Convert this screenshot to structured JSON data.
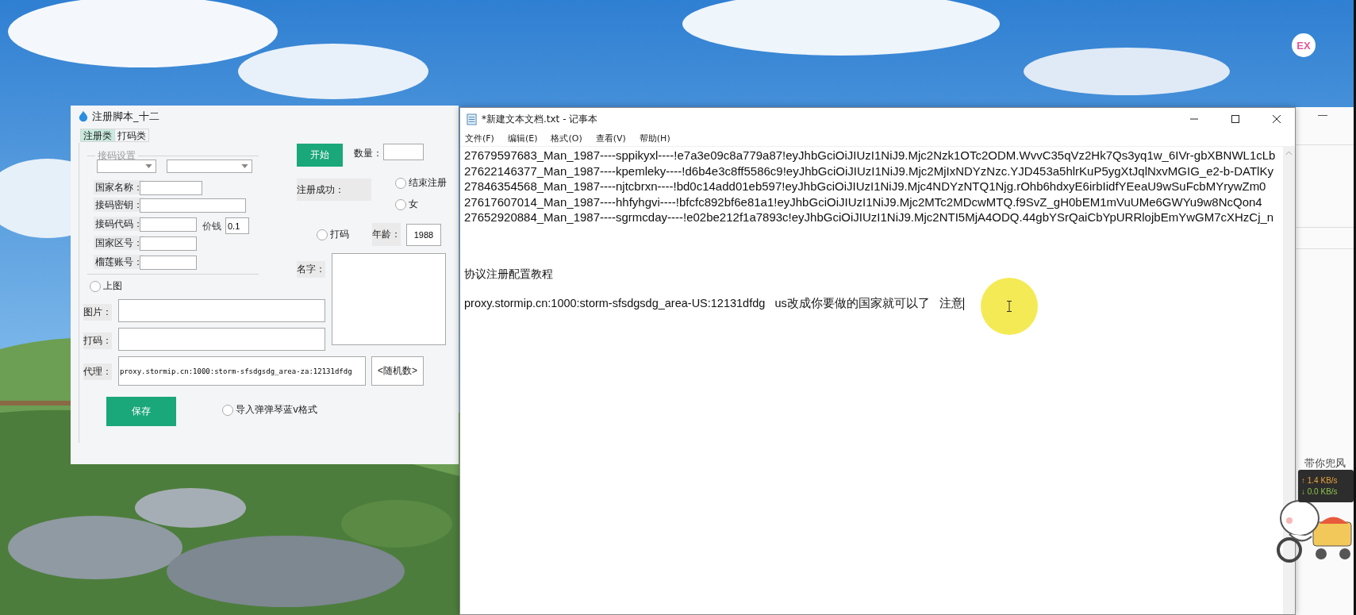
{
  "badge": {
    "text": "EX"
  },
  "register_window": {
    "title": "注册脚本_十二",
    "tabs": [
      {
        "label": "注册类",
        "selected": true
      },
      {
        "label": "打码类",
        "selected": false
      }
    ],
    "group_title": "接码设置",
    "settings_fields": [
      {
        "label": "国家名称："
      },
      {
        "label": "接码密钥："
      },
      {
        "label": "接码代码："
      },
      {
        "label": "国家区号："
      },
      {
        "label": "榴莲账号："
      }
    ],
    "price": {
      "label": "价钱",
      "value": "0.1"
    },
    "start_button": "开始",
    "quantity": {
      "label": "数量："
    },
    "success_label": "注册成功：",
    "radios": [
      {
        "label": "结束注册",
        "checked": false
      },
      {
        "label": "女",
        "checked": false
      },
      {
        "label": "打码",
        "checked": false
      },
      {
        "label": "上图",
        "checked": false
      },
      {
        "label": "导入弹弹琴蓝v格式",
        "checked": false
      }
    ],
    "age": {
      "label": "年龄：",
      "value": "1988"
    },
    "name": {
      "label": "名字："
    },
    "image_field": {
      "label": "图片："
    },
    "captcha_field": {
      "label": "打码："
    },
    "proxy_field": {
      "label": "代理：",
      "value": "proxy.stormip.cn:1000:storm-sfsdgsdg_area-za:12131dfdg"
    },
    "random_button": "<随机数>",
    "save_button": "保存"
  },
  "notepad": {
    "title": "*新建文本文档.txt - 记事本",
    "menu": [
      "文件(F)",
      "编辑(E)",
      "格式(O)",
      "查看(V)",
      "帮助(H)"
    ],
    "lines": [
      "27679597683_Man_1987----sppikyxl----!e7a3e09c8a779a87!eyJhbGciOiJIUzI1NiJ9.Mjc2Nzk1OTc2ODM.WvvC35qVz2Hk7Qs3yq1w_6IVr-gbXBNWL1cLb",
      "27622146377_Man_1987----kpemleky----!d6b4e3c8ff5586c9!eyJhbGciOiJIUzI1NiJ9.Mjc2MjIxNDYzNzc.YJD453a5hlrKuP5ygXtJqlNxvMGIG_e2-b-DATlKy",
      "27846354568_Man_1987----njtcbrxn----!bd0c14add01eb597!eyJhbGciOiJIUzI1NiJ9.Mjc4NDYzNTQ1Njg.rOhb6hdxyE6irbIidfYEeaU9wSuFcbMYrywZm0",
      "27617607014_Man_1987----hhfyhgvi----!bfcfc892bf6e81a1!eyJhbGciOiJIUzI1NiJ9.Mjc2MTc2MDcwMTQ.f9SvZ_gH0bEM1mVuUMe6GWYu9w8NcQon4",
      "27652920884_Man_1987----sgrmcday----!e02be212f1a7893c!eyJhbGciOiJIUzI1NiJ9.Mjc2NTI5MjA4ODQ.44gbYSrQaiCbYpURRlojbEmYwGM7cXHzCj_n"
    ],
    "heading": "协议注册配置教程",
    "note": "proxy.stormip.cn:1000:storm-sfsdgsdg_area-US:12131dfdg   us改成你要做的国家就可以了   注意"
  },
  "net_meter": {
    "caption": "带你兜风",
    "upload": "↑ 1.4 KB/s",
    "download": "↓ 0.0 KB/s"
  }
}
